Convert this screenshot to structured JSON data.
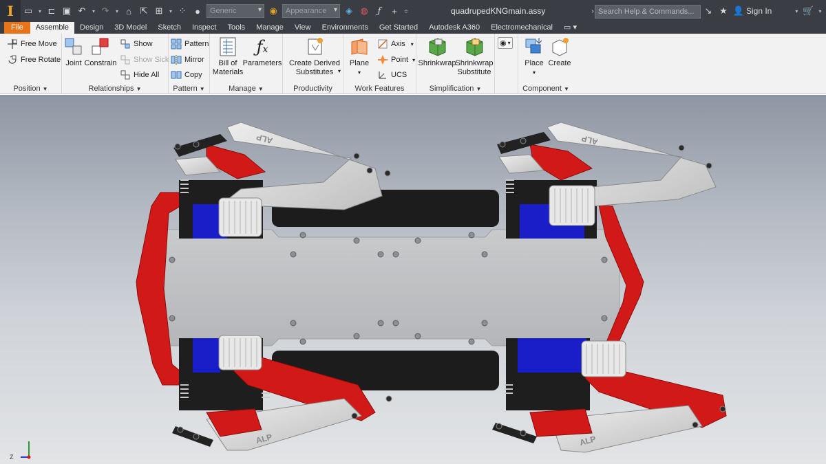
{
  "app": {
    "document_title": "quadrupedKNGmain.assy",
    "search_placeholder": "Search Help & Commands...",
    "sign_in_label": "Sign In",
    "material_combo": "Generic",
    "appearance_combo": "Appearance"
  },
  "tabs": [
    {
      "label": "File"
    },
    {
      "label": "Assemble"
    },
    {
      "label": "Design"
    },
    {
      "label": "3D Model"
    },
    {
      "label": "Sketch"
    },
    {
      "label": "Inspect"
    },
    {
      "label": "Tools"
    },
    {
      "label": "Manage"
    },
    {
      "label": "View"
    },
    {
      "label": "Environments"
    },
    {
      "label": "Get Started"
    },
    {
      "label": "Autodesk A360"
    },
    {
      "label": "Electromechanical"
    }
  ],
  "ribbon": {
    "position": {
      "label": "Position",
      "free_move": "Free Move",
      "free_rotate": "Free Rotate"
    },
    "relationships": {
      "label": "Relationships",
      "joint": "Joint",
      "constrain": "Constrain",
      "show": "Show",
      "show_sick": "Show Sick",
      "hide_all": "Hide All"
    },
    "pattern": {
      "label": "Pattern",
      "pattern": "Pattern",
      "mirror": "Mirror",
      "copy": "Copy"
    },
    "manage": {
      "label": "Manage",
      "bom_line1": "Bill of",
      "bom_line2": "Materials",
      "parameters": "Parameters"
    },
    "productivity": {
      "label": "Productivity",
      "derived_line1": "Create Derived",
      "derived_line2": "Substitutes"
    },
    "work_features": {
      "label": "Work Features",
      "plane": "Plane",
      "axis": "Axis",
      "point": "Point",
      "ucs": "UCS"
    },
    "simplification": {
      "label": "Simplification",
      "shrinkwrap": "Shrinkwrap",
      "shrinkwrap_sub_line1": "Shrinkwrap",
      "shrinkwrap_sub_line2": "Substitute"
    },
    "component": {
      "label": "Component",
      "place": "Place",
      "create": "Create"
    }
  },
  "model": {
    "leg_label": "ALP",
    "triad_z": "Z",
    "colors": {
      "red": "#d11a17",
      "grey": "#d8d8d8",
      "black": "#202020",
      "blue": "#1a1ec8",
      "plate": "#c2c3c5"
    }
  }
}
